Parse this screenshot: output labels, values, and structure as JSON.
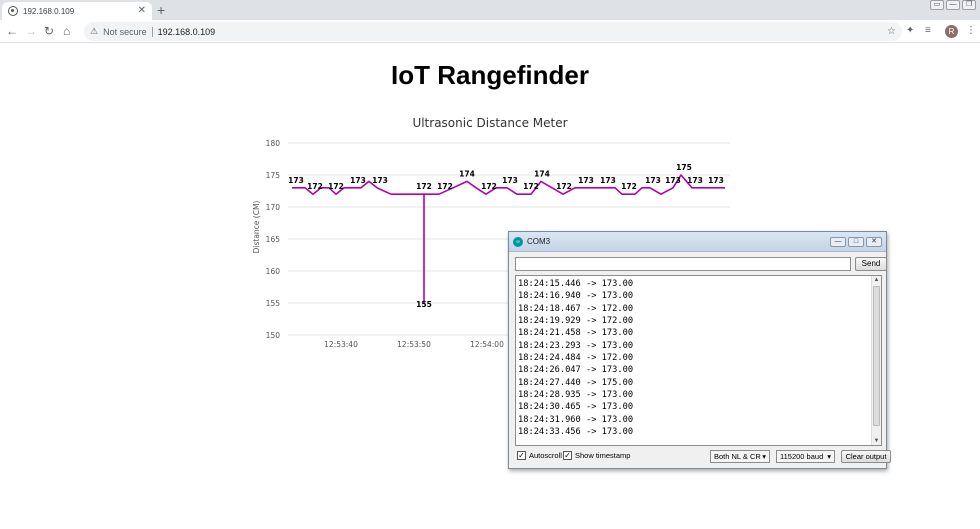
{
  "browser": {
    "tab_title": "192.168.0.109",
    "tab_close": "✕",
    "new_tab": "+",
    "security_label": "Not secure",
    "url": "192.168.0.109",
    "avatar_initial": "R"
  },
  "page": {
    "heading": "IoT Rangefinder"
  },
  "chart_data": {
    "type": "line",
    "title": "Ultrasonic Distance Meter",
    "xlabel": "",
    "ylabel": "Distance (CM)",
    "ylim": [
      150,
      180
    ],
    "yticks": [
      150,
      155,
      160,
      165,
      170,
      175,
      180
    ],
    "xticks": [
      "12:53:40",
      "12:53:50",
      "12:54:00"
    ],
    "grid": true,
    "color": "#b000b0",
    "values": [
      173,
      173,
      172,
      173,
      172,
      173,
      173,
      174,
      173,
      172,
      172,
      172,
      172,
      155,
      172,
      173,
      174,
      173,
      172,
      173,
      173,
      172,
      173,
      174,
      173,
      172,
      173,
      173,
      173,
      173,
      173,
      172,
      172,
      173,
      173,
      172,
      173,
      175,
      173,
      173,
      173,
      173
    ],
    "labels": [
      {
        "i": 0,
        "v": "173"
      },
      {
        "i": 3,
        "v": "172"
      },
      {
        "i": 6,
        "v": "172"
      },
      {
        "i": 9,
        "v": "173"
      },
      {
        "i": 11,
        "v": "173"
      },
      {
        "i": 17,
        "v": "172"
      },
      {
        "i": 19,
        "v": "172"
      },
      {
        "i": 22,
        "v": "174"
      },
      {
        "i": 25,
        "v": "172"
      },
      {
        "i": 27,
        "v": "173"
      },
      {
        "i": 30,
        "v": "172"
      },
      {
        "i": 32,
        "v": "174"
      },
      {
        "i": 34,
        "v": "172"
      },
      {
        "i": 37,
        "v": "173"
      },
      {
        "i": 40,
        "v": "173"
      },
      {
        "i": 43,
        "v": "172"
      },
      {
        "i": 46,
        "v": "173"
      },
      {
        "i": 49,
        "v": "173"
      },
      {
        "i": 50,
        "v": "175"
      },
      {
        "i": 52,
        "v": "173"
      },
      {
        "i": 54,
        "v": "173"
      },
      {
        "i": 14,
        "v": "155"
      }
    ]
  },
  "serial_monitor": {
    "title": "COM3",
    "send_label": "Send",
    "input_value": "",
    "lines": [
      "18:24:15.446 -> 173.00",
      "18:24:16.940 -> 173.00",
      "18:24:18.467 -> 172.00",
      "18:24:19.929 -> 172.00",
      "18:24:21.458 -> 173.00",
      "18:24:23.293 -> 173.00",
      "18:24:24.484 -> 172.00",
      "18:24:26.047 -> 173.00",
      "18:24:27.440 -> 175.00",
      "18:24:28.935 -> 173.00",
      "18:24:30.465 -> 173.00",
      "18:24:31.960 -> 173.00",
      "18:24:33.456 -> 173.00"
    ],
    "autoscroll_label": "Autoscroll",
    "timestamp_label": "Show timestamp",
    "line_ending": "Both NL & CR",
    "baud": "115200 baud",
    "clear_label": "Clear output"
  }
}
